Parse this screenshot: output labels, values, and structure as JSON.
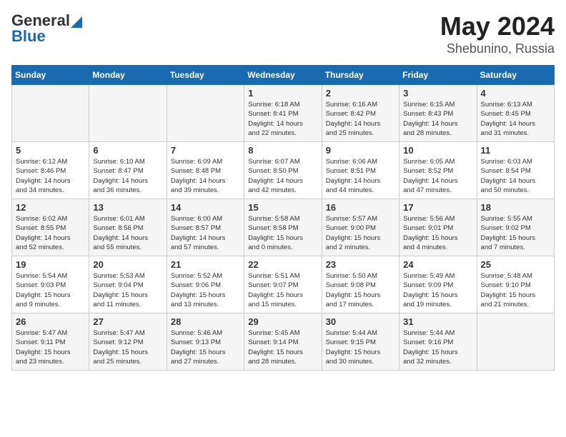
{
  "header": {
    "logo_general": "General",
    "logo_blue": "Blue",
    "month_year": "May 2024",
    "location": "Shebunino, Russia"
  },
  "calendar": {
    "days_of_week": [
      "Sunday",
      "Monday",
      "Tuesday",
      "Wednesday",
      "Thursday",
      "Friday",
      "Saturday"
    ],
    "weeks": [
      [
        {
          "day": "",
          "content": ""
        },
        {
          "day": "",
          "content": ""
        },
        {
          "day": "",
          "content": ""
        },
        {
          "day": "1",
          "content": "Sunrise: 6:18 AM\nSunset: 8:41 PM\nDaylight: 14 hours\nand 22 minutes."
        },
        {
          "day": "2",
          "content": "Sunrise: 6:16 AM\nSunset: 8:42 PM\nDaylight: 14 hours\nand 25 minutes."
        },
        {
          "day": "3",
          "content": "Sunrise: 6:15 AM\nSunset: 8:43 PM\nDaylight: 14 hours\nand 28 minutes."
        },
        {
          "day": "4",
          "content": "Sunrise: 6:13 AM\nSunset: 8:45 PM\nDaylight: 14 hours\nand 31 minutes."
        }
      ],
      [
        {
          "day": "5",
          "content": "Sunrise: 6:12 AM\nSunset: 8:46 PM\nDaylight: 14 hours\nand 34 minutes."
        },
        {
          "day": "6",
          "content": "Sunrise: 6:10 AM\nSunset: 8:47 PM\nDaylight: 14 hours\nand 36 minutes."
        },
        {
          "day": "7",
          "content": "Sunrise: 6:09 AM\nSunset: 8:48 PM\nDaylight: 14 hours\nand 39 minutes."
        },
        {
          "day": "8",
          "content": "Sunrise: 6:07 AM\nSunset: 8:50 PM\nDaylight: 14 hours\nand 42 minutes."
        },
        {
          "day": "9",
          "content": "Sunrise: 6:06 AM\nSunset: 8:51 PM\nDaylight: 14 hours\nand 44 minutes."
        },
        {
          "day": "10",
          "content": "Sunrise: 6:05 AM\nSunset: 8:52 PM\nDaylight: 14 hours\nand 47 minutes."
        },
        {
          "day": "11",
          "content": "Sunrise: 6:03 AM\nSunset: 8:54 PM\nDaylight: 14 hours\nand 50 minutes."
        }
      ],
      [
        {
          "day": "12",
          "content": "Sunrise: 6:02 AM\nSunset: 8:55 PM\nDaylight: 14 hours\nand 52 minutes."
        },
        {
          "day": "13",
          "content": "Sunrise: 6:01 AM\nSunset: 8:56 PM\nDaylight: 14 hours\nand 55 minutes."
        },
        {
          "day": "14",
          "content": "Sunrise: 6:00 AM\nSunset: 8:57 PM\nDaylight: 14 hours\nand 57 minutes."
        },
        {
          "day": "15",
          "content": "Sunrise: 5:58 AM\nSunset: 8:58 PM\nDaylight: 15 hours\nand 0 minutes."
        },
        {
          "day": "16",
          "content": "Sunrise: 5:57 AM\nSunset: 9:00 PM\nDaylight: 15 hours\nand 2 minutes."
        },
        {
          "day": "17",
          "content": "Sunrise: 5:56 AM\nSunset: 9:01 PM\nDaylight: 15 hours\nand 4 minutes."
        },
        {
          "day": "18",
          "content": "Sunrise: 5:55 AM\nSunset: 9:02 PM\nDaylight: 15 hours\nand 7 minutes."
        }
      ],
      [
        {
          "day": "19",
          "content": "Sunrise: 5:54 AM\nSunset: 9:03 PM\nDaylight: 15 hours\nand 9 minutes."
        },
        {
          "day": "20",
          "content": "Sunrise: 5:53 AM\nSunset: 9:04 PM\nDaylight: 15 hours\nand 11 minutes."
        },
        {
          "day": "21",
          "content": "Sunrise: 5:52 AM\nSunset: 9:06 PM\nDaylight: 15 hours\nand 13 minutes."
        },
        {
          "day": "22",
          "content": "Sunrise: 5:51 AM\nSunset: 9:07 PM\nDaylight: 15 hours\nand 15 minutes."
        },
        {
          "day": "23",
          "content": "Sunrise: 5:50 AM\nSunset: 9:08 PM\nDaylight: 15 hours\nand 17 minutes."
        },
        {
          "day": "24",
          "content": "Sunrise: 5:49 AM\nSunset: 9:09 PM\nDaylight: 15 hours\nand 19 minutes."
        },
        {
          "day": "25",
          "content": "Sunrise: 5:48 AM\nSunset: 9:10 PM\nDaylight: 15 hours\nand 21 minutes."
        }
      ],
      [
        {
          "day": "26",
          "content": "Sunrise: 5:47 AM\nSunset: 9:11 PM\nDaylight: 15 hours\nand 23 minutes."
        },
        {
          "day": "27",
          "content": "Sunrise: 5:47 AM\nSunset: 9:12 PM\nDaylight: 15 hours\nand 25 minutes."
        },
        {
          "day": "28",
          "content": "Sunrise: 5:46 AM\nSunset: 9:13 PM\nDaylight: 15 hours\nand 27 minutes."
        },
        {
          "day": "29",
          "content": "Sunrise: 5:45 AM\nSunset: 9:14 PM\nDaylight: 15 hours\nand 28 minutes."
        },
        {
          "day": "30",
          "content": "Sunrise: 5:44 AM\nSunset: 9:15 PM\nDaylight: 15 hours\nand 30 minutes."
        },
        {
          "day": "31",
          "content": "Sunrise: 5:44 AM\nSunset: 9:16 PM\nDaylight: 15 hours\nand 32 minutes."
        },
        {
          "day": "",
          "content": ""
        }
      ]
    ]
  }
}
